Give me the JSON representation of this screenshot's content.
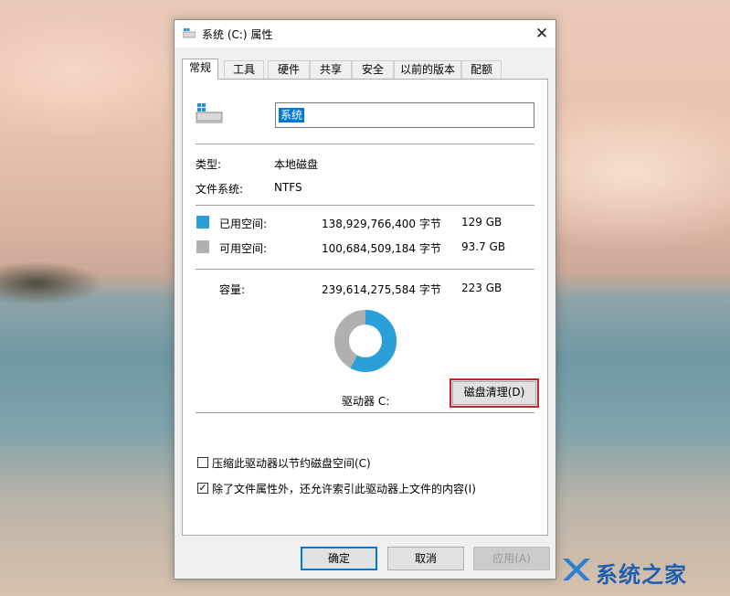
{
  "window": {
    "title": "系统 (C:) 属性",
    "close": "✕"
  },
  "tabs": [
    {
      "label": "常规",
      "active": true
    },
    {
      "label": "工具"
    },
    {
      "label": "硬件"
    },
    {
      "label": "共享"
    },
    {
      "label": "安全"
    },
    {
      "label": "以前的版本"
    },
    {
      "label": "配额"
    }
  ],
  "general": {
    "drive_name": "系统",
    "type_label": "类型:",
    "type_value": "本地磁盘",
    "fs_label": "文件系统:",
    "fs_value": "NTFS",
    "used": {
      "label": "已用空间:",
      "bytes": "138,929,766,400 字节",
      "size": "129 GB",
      "color": "#2a9fd8"
    },
    "free": {
      "label": "可用空间:",
      "bytes": "100,684,509,184 字节",
      "size": "93.7 GB",
      "color": "#b0b0b0"
    },
    "capacity": {
      "label": "容量:",
      "bytes": "239,614,275,584 字节",
      "size": "223 GB"
    },
    "used_fraction": 0.58,
    "drive_label": "驱动器 C:",
    "cleanup_button": "磁盘清理(D)",
    "compress_option": {
      "label": "压缩此驱动器以节约磁盘空间(C)",
      "checked": false
    },
    "index_option": {
      "label": "除了文件属性外，还允许索引此驱动器上文件的内容(I)",
      "checked": true,
      "mark": "✓"
    }
  },
  "buttons": {
    "ok": "确定",
    "cancel": "取消",
    "apply": "应用(A)"
  },
  "watermark": {
    "text": "系统之家"
  },
  "accent": "#0078d7",
  "highlight_border": "#c0272d"
}
